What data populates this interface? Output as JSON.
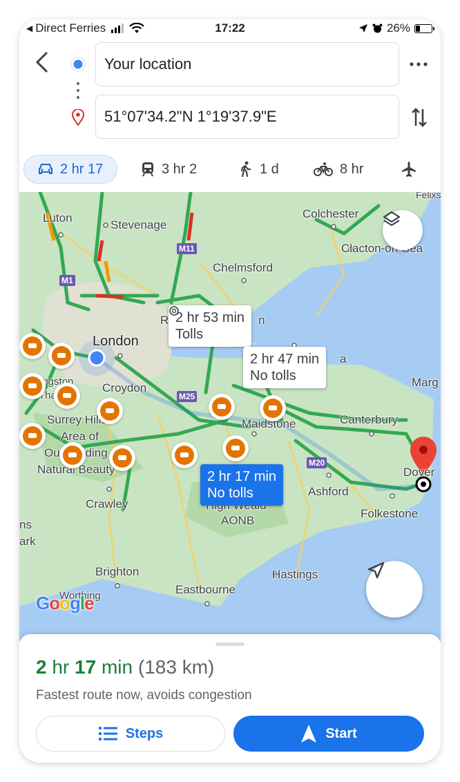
{
  "status_bar": {
    "back_app": "Direct Ferries",
    "time": "17:22",
    "battery": "26%"
  },
  "directions": {
    "origin": "Your location",
    "destination": "51°07'34.2\"N 1°19'37.9\"E"
  },
  "modes": [
    {
      "name": "drive",
      "label": "2 hr 17",
      "active": true
    },
    {
      "name": "transit",
      "label": "3 hr 2"
    },
    {
      "name": "walk",
      "label": "1 d"
    },
    {
      "name": "cycle",
      "label": "8 hr"
    },
    {
      "name": "fly",
      "label": ""
    }
  ],
  "map": {
    "places": {
      "luton": "Luton",
      "stevenage": "Stevenage",
      "colchester": "Colchester",
      "felixstowe": "Felixsto",
      "clacton": "Clacton-on-Sea",
      "chelmsford": "Chelmsford",
      "london": "London",
      "croydon": "Croydon",
      "kingston": "Kingston",
      "tha": "Tha",
      "surrey_hills": "Surrey Hills",
      "area_of": "Area of",
      "outstanding": "Outstanding",
      "natural_beauty": "Natural Beauty",
      "crawley": "Crawley",
      "high_weald": "High Weald",
      "aonb": "AONB",
      "maidstone": "Maidstone",
      "canterbury": "Canterbury",
      "margate": "Marg",
      "ashford": "Ashford",
      "folkestone": "Folkestone",
      "dover": "Dover",
      "brighton": "Brighton",
      "eastbourne": "Eastbourne",
      "hastings": "Hastings",
      "worthing": "Worthing",
      "fragment_r": "R",
      "fragment_n": "n",
      "fragment_a": "a",
      "fragment_h": "h",
      "fragment_ns": "ns",
      "fragment_ark": "ark"
    },
    "motorways": {
      "m1": "M1",
      "m11": "M11",
      "m25": "M25",
      "m20": "M20"
    },
    "routes": [
      {
        "time": "2 hr 53 min",
        "detail": "Tolls",
        "selected": false
      },
      {
        "time": "2 hr 47 min",
        "detail": "No tolls",
        "selected": false
      },
      {
        "time": "2 hr 17 min",
        "detail": "No tolls",
        "selected": true
      }
    ],
    "logo": "Google"
  },
  "sheet": {
    "duration_hr": "2",
    "hr_label": "hr",
    "duration_min": "17",
    "min_label": "min",
    "distance": "(183 km)",
    "description": "Fastest route now, avoids congestion",
    "steps_label": "Steps",
    "start_label": "Start"
  },
  "colors": {
    "accent": "#1a73e8",
    "route_green": "#34a853",
    "traffic_red": "#d93025",
    "water": "#a6ccf4",
    "land": "#c8e6c9"
  }
}
